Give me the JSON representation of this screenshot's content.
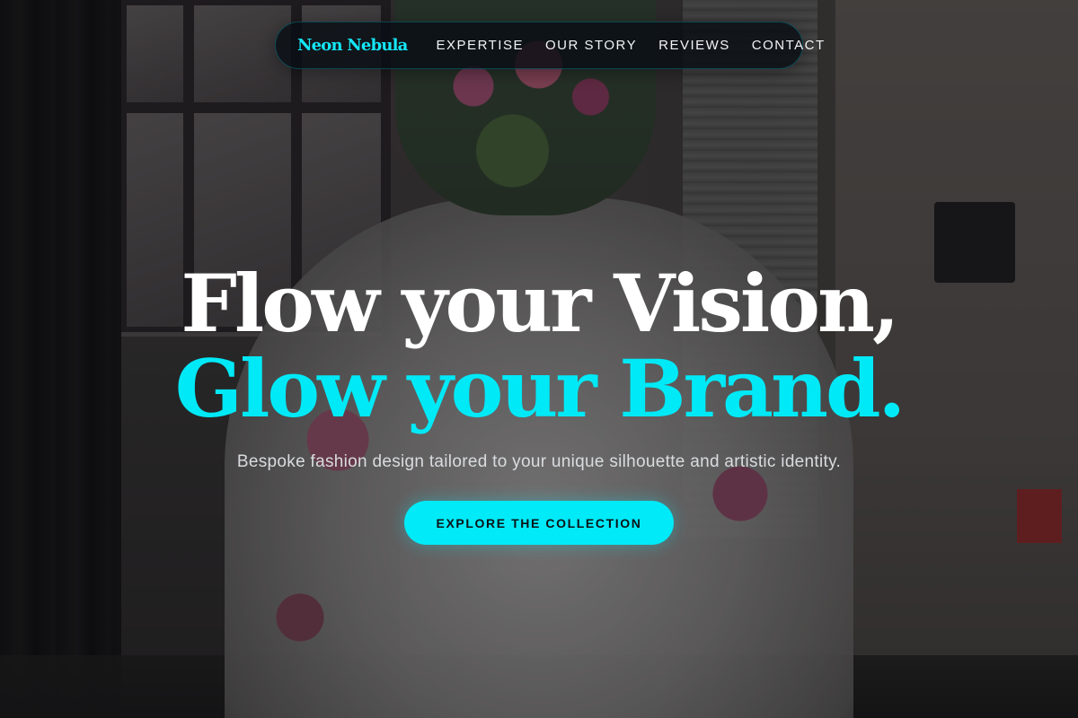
{
  "nav": {
    "brand": "Neon Nebula",
    "links": [
      {
        "label": "EXPERTISE"
      },
      {
        "label": "OUR STORY"
      },
      {
        "label": "REVIEWS"
      },
      {
        "label": "CONTACT"
      }
    ]
  },
  "hero": {
    "headline_line1": "Flow your Vision,",
    "headline_line2": "Glow your Brand.",
    "subtitle": "Bespoke fashion design tailored to your unique silhouette and artistic identity.",
    "cta_label": "EXPLORE THE COLLECTION",
    "background_image": "floral-dress-mannequin-in-studio"
  },
  "colors": {
    "accent": "#00E9F7",
    "headline_primary": "#FFFFFF",
    "nav_background": "#080E14",
    "cta_text": "#0B1216"
  }
}
